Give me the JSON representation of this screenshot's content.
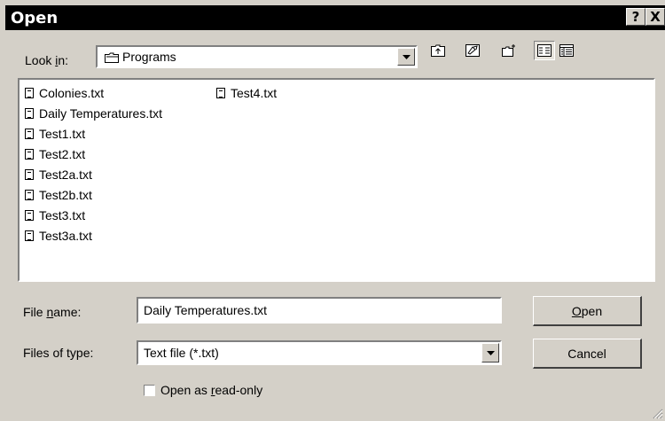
{
  "window": {
    "title": "Open",
    "help_glyph": "?",
    "close_glyph": "X"
  },
  "toolbar": {
    "look_in_prefix": "Look ",
    "look_in_hotkey": "i",
    "look_in_suffix": "n:",
    "look_in_value": "Programs",
    "icons": [
      "up-one-level-icon",
      "desktop-icon",
      "create-new-folder-icon",
      "list-view-icon",
      "details-view-icon"
    ]
  },
  "files": [
    "Colonies.txt",
    "Daily Temperatures.txt",
    "Test1.txt",
    "Test2.txt",
    "Test2a.txt",
    "Test2b.txt",
    "Test3.txt",
    "Test3a.txt",
    "Test4.txt"
  ],
  "form": {
    "file_name_prefix": "File ",
    "file_name_hotkey": "n",
    "file_name_suffix": "ame:",
    "file_name_value": "Daily Temperatures.txt",
    "files_of_type_label": "Files of type:",
    "files_of_type_value": "Text file (*.txt)",
    "read_only_prefix": "Open as ",
    "read_only_hotkey": "r",
    "read_only_suffix": "ead-only",
    "read_only_checked": false
  },
  "buttons": {
    "open_hotkey": "O",
    "open_rest": "pen",
    "cancel": "Cancel"
  }
}
